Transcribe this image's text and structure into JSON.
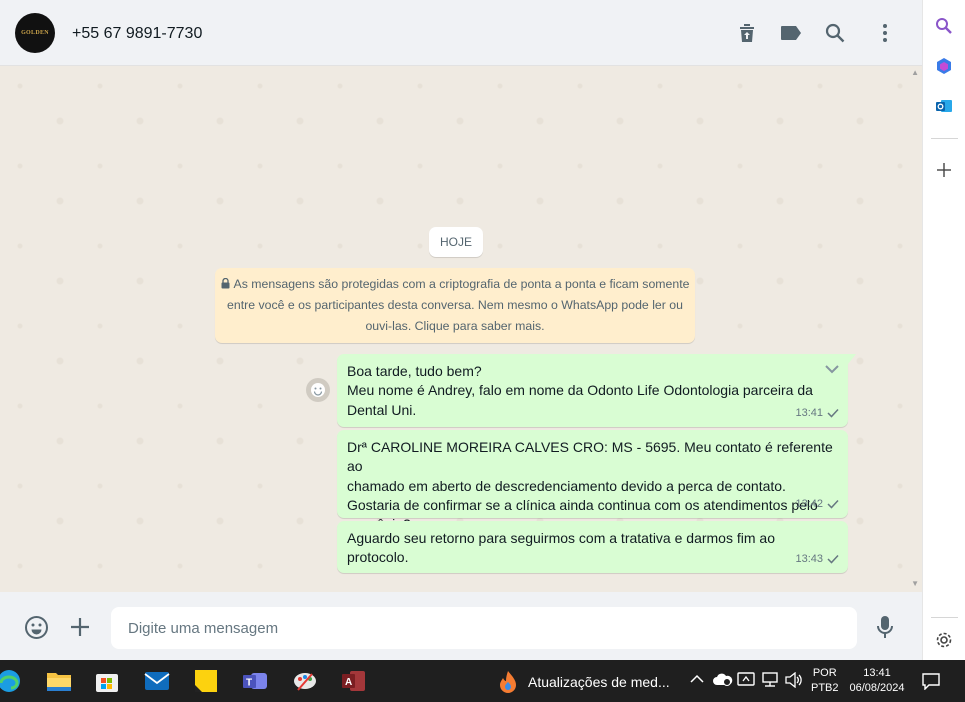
{
  "header": {
    "avatar_text": "GOLDEN",
    "contact_name": "+55 67 9891-7730",
    "icons": [
      "delete-icon",
      "label-icon",
      "search-icon",
      "more-icon"
    ]
  },
  "chat": {
    "day_label": "HOJE",
    "encryption_notice": "As mensagens são protegidas com a criptografia de ponta a ponta e ficam somente entre você e os participantes desta conversa. Nem mesmo o WhatsApp pode ler ou ouvi-las. Clique para saber mais.",
    "messages": [
      {
        "lines": [
          "Boa tarde, tudo bem?",
          "Meu nome é Andrey, falo em nome da Odonto Life Odontologia parceira da",
          "Dental Uni."
        ],
        "time": "13:41"
      },
      {
        "lines": [
          "Drª CAROLINE MOREIRA CALVES CRO: MS - 5695. Meu contato é referente ao",
          "chamado em aberto de descredenciamento devido a perca de contato.",
          "Gostaria de confirmar se a clínica ainda continua com os atendimentos pelo",
          "convênio?"
        ],
        "time": "13:42"
      },
      {
        "lines": [
          "Aguardo seu retorno para seguirmos com a tratativa e darmos fim ao",
          "protocolo."
        ],
        "time": "13:43"
      }
    ]
  },
  "composer": {
    "placeholder": "Digite uma mensagem"
  },
  "taskbar": {
    "update_text": "Atualizações de med...",
    "lang_top": "POR",
    "lang_bottom": "PTB2",
    "time": "13:41",
    "date": "06/08/2024"
  },
  "colors": {
    "outgoing_bubble": "#d9fdd3",
    "notice_bg": "#ffeecd",
    "chat_bg": "#efeae2"
  }
}
